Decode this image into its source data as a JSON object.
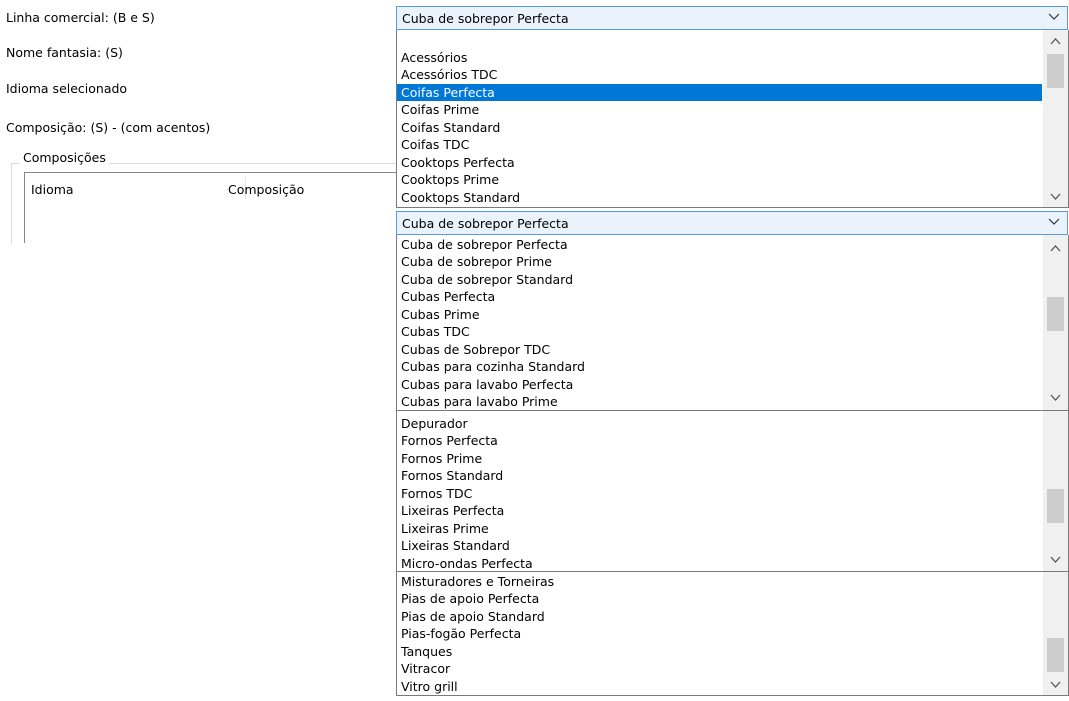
{
  "form": {
    "linha_label": "Linha comercial: (B e S)",
    "nome_label": "Nome fantasia: (S)",
    "idioma_label": "Idioma selecionado",
    "composicao_label": "Composição: (S) - (com acentos)"
  },
  "group": {
    "title": "Composições",
    "columns": [
      "Idioma",
      "Composição"
    ]
  },
  "combo1": {
    "value": "Cuba de sobrepor Perfecta",
    "items": [
      "Acessórios",
      "Acessórios TDC",
      "Coifas Perfecta",
      "Coifas Prime",
      "Coifas Standard",
      "Coifas TDC",
      "Cooktops Perfecta",
      "Cooktops Prime",
      "Cooktops Standard"
    ],
    "highlighted": "Coifas Perfecta"
  },
  "combo2": {
    "value": "Cuba de sobrepor Perfecta",
    "items_page1": [
      "Cuba de sobrepor Perfecta",
      "Cuba de sobrepor Prime",
      "Cuba de sobrepor Standard",
      "Cubas Perfecta",
      "Cubas Prime",
      "Cubas TDC",
      "Cubas de Sobrepor TDC",
      "Cubas para cozinha Standard",
      "Cubas para lavabo Perfecta",
      "Cubas para lavabo Prime"
    ],
    "items_page2": [
      "Depurador",
      "Fornos Perfecta",
      "Fornos Prime",
      "Fornos Standard",
      "Fornos TDC",
      "Lixeiras Perfecta",
      "Lixeiras Prime",
      "Lixeiras Standard",
      "Micro-ondas Perfecta"
    ],
    "items_page3": [
      "Misturadores e Torneiras",
      "Pias de apoio Perfecta",
      "Pias de apoio Standard",
      "Pias-fogão Perfecta",
      "Tanques",
      "Vitracor",
      "Vitro grill"
    ]
  },
  "icons": {
    "dropdown": "chevron-down-icon",
    "scroll_up": "chevron-up-icon",
    "scroll_down": "chevron-down-icon"
  },
  "colors": {
    "highlight": "#0078d7",
    "combo_border": "#5a9bd5",
    "combo_bg": "#eaf3fb"
  }
}
